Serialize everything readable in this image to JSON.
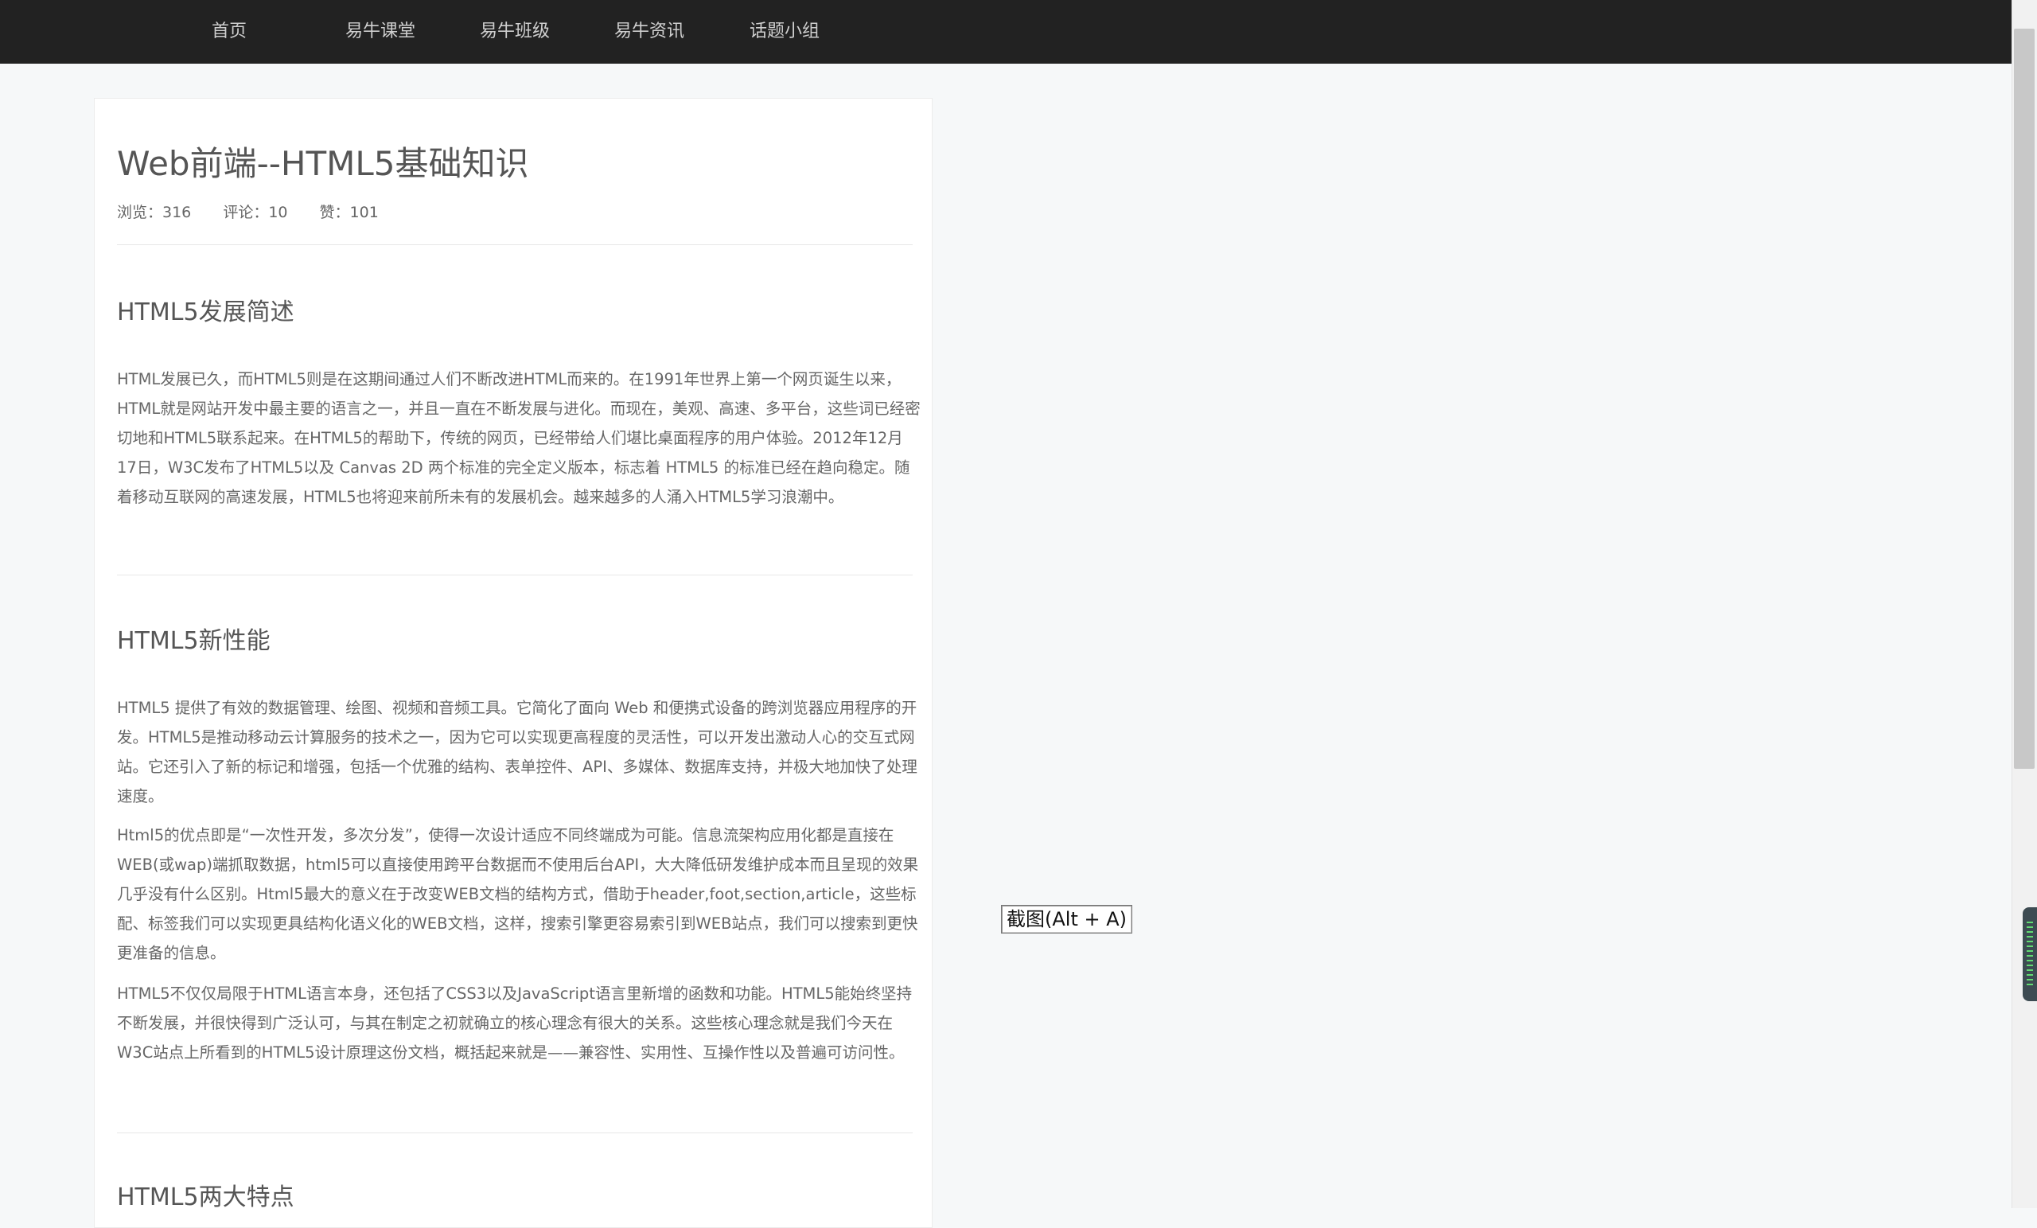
{
  "nav": {
    "items": [
      {
        "label": "首页"
      },
      {
        "label": "易牛课堂"
      },
      {
        "label": "易牛班级"
      },
      {
        "label": "易牛资讯"
      },
      {
        "label": "话题小组"
      }
    ]
  },
  "article": {
    "title": "Web前端--HTML5基础知识",
    "meta": {
      "views": "浏览：316",
      "comments": "评论：10",
      "likes": "赞：101"
    },
    "sections": [
      {
        "heading": "HTML5发展简述",
        "paragraphs": [
          "HTML发展已久，而HTML5则是在这期间通过人们不断改进HTML而来的。在1991年世界上第一个网页诞生以来，HTML就是网站开发中最主要的语言之一，并且一直在不断发展与进化。而现在，美观、高速、多平台，这些词已经密切地和HTML5联系起来。在HTML5的帮助下，传统的网页，已经带给人们堪比桌面程序的用户体验。2012年12月 17日，W3C发布了HTML5以及 Canvas 2D 两个标准的完全定义版本，标志着 HTML5 的标准已经在趋向稳定。随着移动互联网的高速发展，HTML5也将迎来前所未有的发展机会。越来越多的人涌入HTML5学习浪潮中。"
        ]
      },
      {
        "heading": "HTML5新性能",
        "paragraphs": [
          "HTML5 提供了有效的数据管理、绘图、视频和音频工具。它简化了面向 Web 和便携式设备的跨浏览器应用程序的开发。HTML5是推动移动云计算服务的技术之一，因为它可以实现更高程度的灵活性，可以开发出激动人心的交互式网站。它还引入了新的标记和增强，包括一个优雅的结构、表单控件、API、多媒体、数据库支持，并极大地加快了处理速度。",
          "Html5的优点即是“一次性开发，多次分发”，使得一次设计适应不同终端成为可能。信息流架构应用化都是直接在WEB(或wap)端抓取数据，html5可以直接使用跨平台数据而不使用后台API，大大降低研发维护成本而且呈现的效果几乎没有什么区别。Html5最大的意义在于改变WEB文档的结构方式，借助于header,foot,section,article，这些标配、标签我们可以实现更具结构化语义化的WEB文档，这样，搜索引擎更容易索引到WEB站点，我们可以搜索到更快更准备的信息。",
          "HTML5不仅仅局限于HTML语言本身，还包括了CSS3以及JavaScript语言里新增的函数和功能。HTML5能始终坚持不断发展，并很快得到广泛认可，与其在制定之初就确立的核心理念有很大的关系。这些核心理念就是我们今天在W3C站点上所看到的HTML5设计原理这份文档，概括起来就是——兼容性、实用性、互操作性以及普遍可访问性。"
        ]
      },
      {
        "heading": "HTML5两大特点"
      }
    ]
  },
  "overlay": {
    "screenshot_tip": "截图(Alt + A)"
  }
}
